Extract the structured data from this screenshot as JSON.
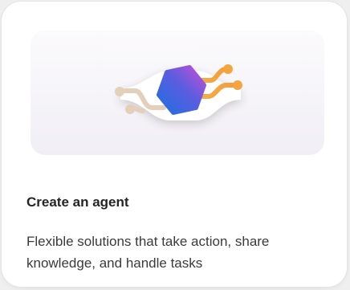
{
  "card": {
    "title": "Create an agent",
    "description": "Flexible solutions that take action, share knowledge, and handle tasks",
    "illustration_icon": "agent-hexagon-connector-icon"
  },
  "colors": {
    "hexagon_blue": "#2f6fd8",
    "hexagon_purple": "#b44fd9",
    "connector_orange": "#f4a640",
    "connector_beige": "#e7d3bd"
  }
}
